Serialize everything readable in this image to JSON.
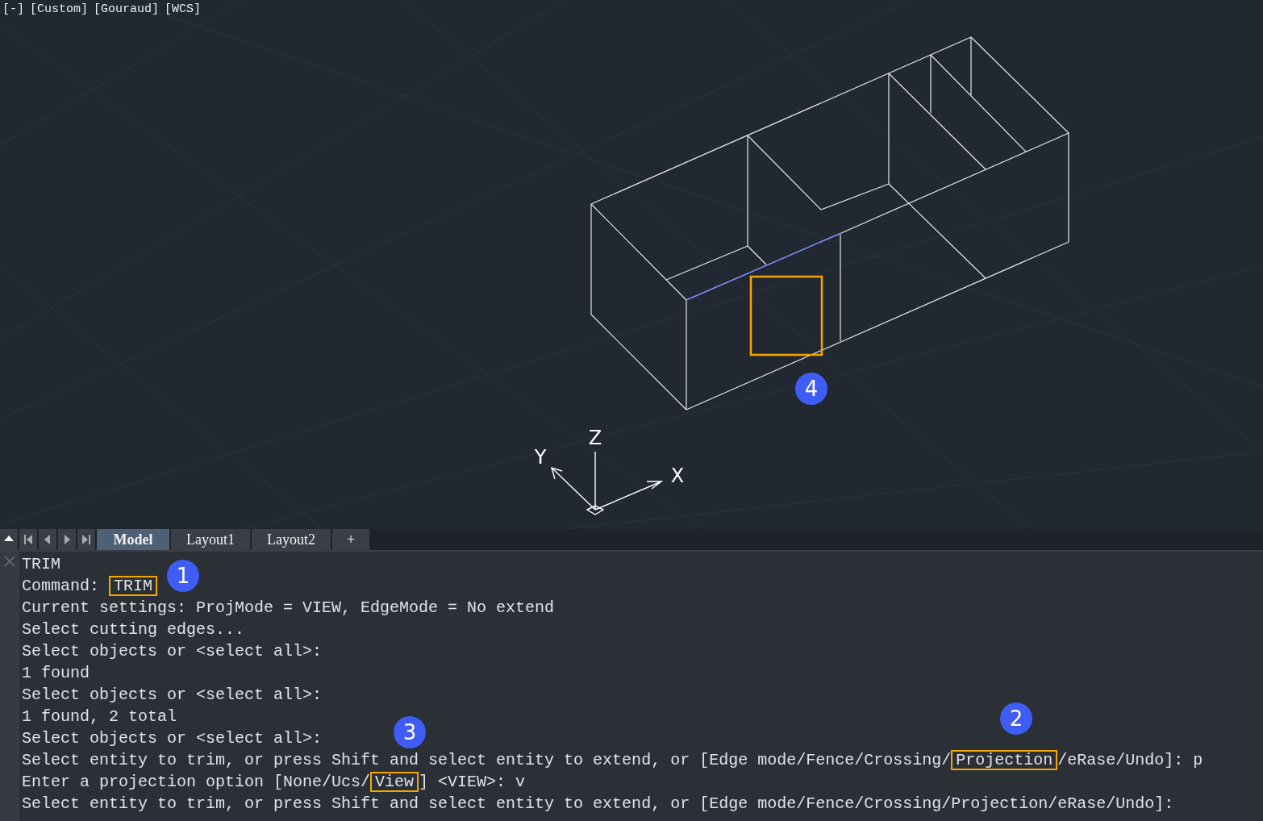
{
  "viewport": {
    "controls": [
      {
        "label": "[-]"
      },
      {
        "label": "[Custom]"
      },
      {
        "label": "[Gouraud]"
      },
      {
        "label": "[WCS]"
      }
    ],
    "axes": {
      "x": "X",
      "y": "Y",
      "z": "Z"
    }
  },
  "tabs": [
    {
      "label": "Model",
      "selected": true
    },
    {
      "label": "Layout1",
      "selected": false
    },
    {
      "label": "Layout2",
      "selected": false
    },
    {
      "label": "+",
      "selected": false
    }
  ],
  "command_lines": [
    {
      "parts": [
        {
          "text": "TRIM",
          "highlighted": false
        }
      ]
    },
    {
      "parts": [
        {
          "text": "Command: ",
          "highlighted": false
        },
        {
          "text": "TRIM",
          "highlighted": true
        }
      ]
    },
    {
      "parts": [
        {
          "text": "Current settings: ProjMode = VIEW, EdgeMode = No extend",
          "highlighted": false
        }
      ]
    },
    {
      "parts": [
        {
          "text": "Select cutting edges...",
          "highlighted": false
        }
      ]
    },
    {
      "parts": [
        {
          "text": "Select objects or <select all>:",
          "highlighted": false
        }
      ]
    },
    {
      "parts": [
        {
          "text": "1 found",
          "highlighted": false
        }
      ]
    },
    {
      "parts": [
        {
          "text": "Select objects or <select all>:",
          "highlighted": false
        }
      ]
    },
    {
      "parts": [
        {
          "text": "1 found, 2 total",
          "highlighted": false
        }
      ]
    },
    {
      "parts": [
        {
          "text": "Select objects or <select all>:",
          "highlighted": false
        }
      ]
    },
    {
      "parts": [
        {
          "text": "Select entity to trim, or press Shift and select entity to extend, or [Edge mode/Fence/Crossing/",
          "highlighted": false
        },
        {
          "text": "Projection",
          "highlighted": true
        },
        {
          "text": "/eRase/Undo]: p",
          "highlighted": false
        }
      ]
    },
    {
      "parts": [
        {
          "text": "Enter a projection option [None/Ucs/",
          "highlighted": false
        },
        {
          "text": "View",
          "highlighted": true
        },
        {
          "text": "] <VIEW>: v",
          "highlighted": false
        }
      ]
    },
    {
      "parts": [
        {
          "text": "Select entity to trim, or press Shift and select entity to extend, or [Edge mode/Fence/Crossing/Projection/eRase/Undo]:",
          "highlighted": false
        }
      ]
    }
  ],
  "callouts": [
    {
      "label": "1"
    },
    {
      "label": "2"
    },
    {
      "label": "3"
    },
    {
      "label": "4"
    }
  ]
}
